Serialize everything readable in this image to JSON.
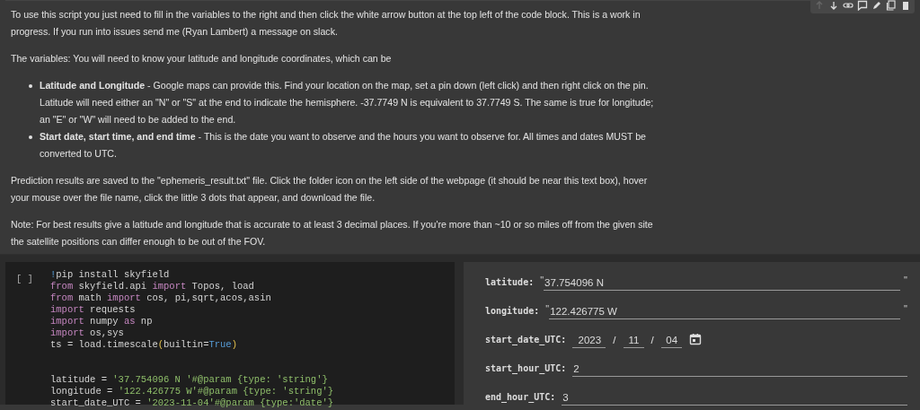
{
  "text_cell": {
    "paragraphs": [
      {
        "kind": "para",
        "text": "To use this script you just need to fill in the variables to the right and then click the white arrow button at the top left of the code block. This is a work in progress. If you run into issues send me (Ryan Lambert) a message on slack."
      },
      {
        "kind": "para",
        "text": "The variables: You will need to know your latitude and longitude coordinates, which can be"
      },
      {
        "kind": "list",
        "items": [
          "**Latitude and Longitude** - Google maps can provide this. Find your location on the map, set a pin down (left click) and then right click on the pin. Latitude will need either an \"N\" or \"S\" at the end to indicate the hemisphere. -37.7749 N is equivalent to 37.7749 S. The same is true for longitude; an \"E\" or \"W\" will need to be added to the end.",
          "**Start date, start time, and end time** - This is the date you want to observe and the hours you want to observe for. All times and dates MUST be converted to UTC."
        ]
      },
      {
        "kind": "para",
        "text": "Prediction results are saved to the \"ephemeris_result.txt\" file. Click the folder icon on the left side of the webpage (it should be near this text box), hover your mouse over the file name, click the little 3 dots that appear, and download the file."
      },
      {
        "kind": "para",
        "text": "Note: For best results give a latitude and longitude that is accurate to at least 3 decimal places. If you're more than ~10 or so miles off from the given site the satellite positions can differ enough to be out of the FOV."
      }
    ]
  },
  "code_cell": {
    "run_marker": "[ ]",
    "blocks": [
      [
        [
          {
            "kind": "bang",
            "text": "!"
          },
          {
            "kind": "plain",
            "text": "pip install skyfield"
          }
        ],
        [
          {
            "kind": "kw",
            "text": "from"
          },
          {
            "kind": "plain",
            "text": " skyfield.api "
          },
          {
            "kind": "kw",
            "text": "import"
          },
          {
            "kind": "plain",
            "text": " Topos, load"
          }
        ],
        [
          {
            "kind": "kw",
            "text": "from"
          },
          {
            "kind": "plain",
            "text": " math "
          },
          {
            "kind": "kw",
            "text": "import"
          },
          {
            "kind": "plain",
            "text": " cos, pi,sqrt,acos,asin"
          }
        ],
        [
          {
            "kind": "kw",
            "text": "import"
          },
          {
            "kind": "plain",
            "text": " requests"
          }
        ],
        [
          {
            "kind": "kw",
            "text": "import"
          },
          {
            "kind": "plain",
            "text": " numpy "
          },
          {
            "kind": "kw",
            "text": "as"
          },
          {
            "kind": "plain",
            "text": " np"
          }
        ],
        [
          {
            "kind": "kw",
            "text": "import"
          },
          {
            "kind": "plain",
            "text": " os,sys"
          }
        ],
        [
          {
            "kind": "plain",
            "text": "ts = load.timescale"
          },
          {
            "kind": "paren",
            "text": "("
          },
          {
            "kind": "plain",
            "text": "builtin="
          },
          {
            "kind": "bool",
            "text": "True"
          },
          {
            "kind": "paren",
            "text": ")"
          }
        ]
      ],
      [
        [
          {
            "kind": "plain",
            "text": "latitude = "
          },
          {
            "kind": "str",
            "text": "'37.754096 N '#@param {type: 'string'}"
          }
        ],
        [
          {
            "kind": "plain",
            "text": "longitude = "
          },
          {
            "kind": "str",
            "text": "'122.426775 W'#@param {type: 'string'}"
          }
        ],
        [
          {
            "kind": "plain",
            "text": "start_date_UTC = "
          },
          {
            "kind": "str",
            "text": "'2023-11-04'#@param {type:'date'}"
          }
        ]
      ]
    ]
  },
  "form": [
    {
      "kind": "text",
      "label": "latitude:",
      "value": "37.754096 N",
      "open_quote": "\"",
      "close_quote": "\""
    },
    {
      "kind": "text",
      "label": "longitude:",
      "value": "122.426775 W",
      "open_quote": "\"",
      "close_quote": "\""
    },
    {
      "kind": "date",
      "label": "start_date_UTC:",
      "parts": [
        "2023",
        "11",
        "04"
      ],
      "separator": "/"
    },
    {
      "kind": "number",
      "label": "start_hour_UTC:",
      "value": "2"
    },
    {
      "kind": "number",
      "label": "end_hour_UTC:",
      "value": "3"
    }
  ]
}
